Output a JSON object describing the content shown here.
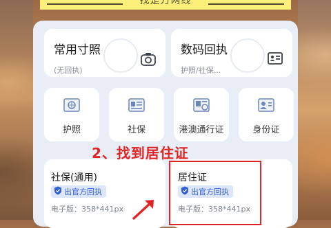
{
  "banner": {
    "text": "找是万两线"
  },
  "cards": {
    "passport_photo": {
      "title": "常用寸照",
      "subtitle": "(无回执)",
      "icon": "camera-icon"
    },
    "digital_receipt": {
      "title": "数码回执",
      "subtitle": "护照/社保...",
      "icon": "id-card-icon"
    }
  },
  "categories": [
    {
      "label": "护照",
      "icon": "passport-icon"
    },
    {
      "label": "社保",
      "icon": "social-security-card-icon"
    },
    {
      "label": "港澳通行证",
      "icon": "hk-macau-permit-icon"
    },
    {
      "label": "身份证",
      "icon": "id-card-portrait-icon"
    }
  ],
  "annotation": {
    "step_text": "2、找到居住证",
    "color": "#e02424"
  },
  "products": [
    {
      "title": "社保(通用)",
      "badge": "出官方回执",
      "meta": "电子版：358*441px"
    },
    {
      "title": "居住证",
      "badge": "出官方回执",
      "meta": "电子版：358*441px"
    }
  ],
  "colors": {
    "accent": "#2f5fd0",
    "highlight": "#e02424",
    "banner": "#fdf07a"
  }
}
